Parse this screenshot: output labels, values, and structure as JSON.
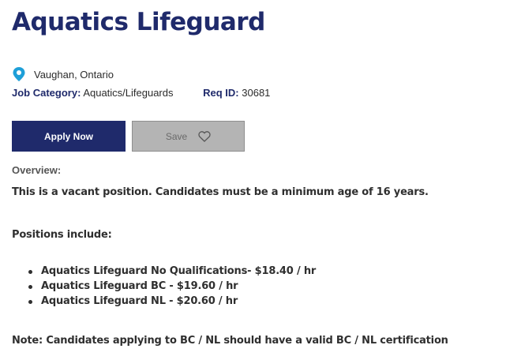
{
  "job": {
    "title": "Aquatics Lifeguard",
    "location": "Vaughan, Ontario",
    "category_label": "Job Category:",
    "category_value": "Aquatics/Lifeguards",
    "req_label": "Req ID:",
    "req_value": "30681"
  },
  "actions": {
    "apply_label": "Apply Now",
    "save_label": "Save"
  },
  "icons": {
    "location": "map-pin-icon",
    "save": "heart-icon",
    "pin_color": "#1e9fd8"
  },
  "description": {
    "overview_label": "Overview:",
    "vacant_text": "This is a vacant position. Candidates must be a minimum age of 16 years.",
    "positions_label": "Positions include:",
    "positions": [
      "Aquatics Lifeguard No Qualifications- $18.40 / hr",
      "Aquatics Lifeguard BC - $19.60 / hr",
      "Aquatics Lifeguard NL - $20.60 / hr"
    ],
    "note": "Note: Candidates applying to BC / NL should have a valid BC / NL certification"
  },
  "colors": {
    "brand": "#1f2a6b",
    "save_bg": "#b4b4b4"
  }
}
